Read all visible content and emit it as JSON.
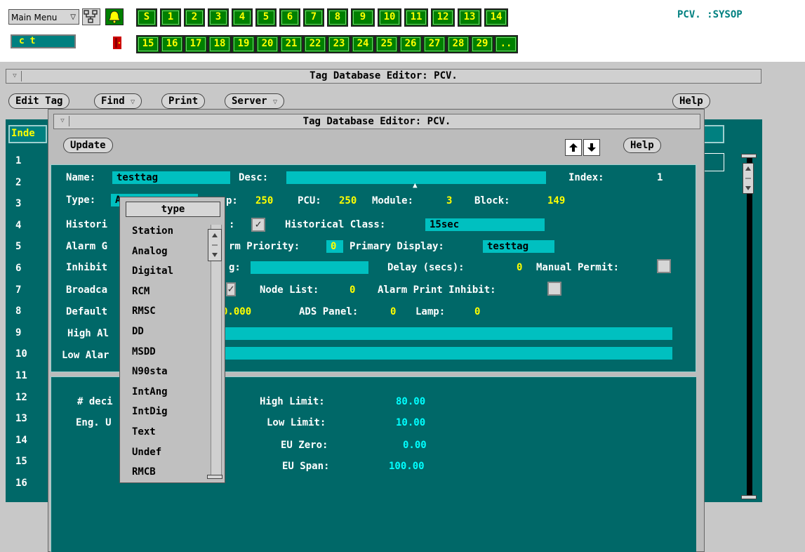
{
  "topbar": {
    "menu_label": "Main Menu",
    "menu_arrow": "▽",
    "ct_field": "c  t",
    "user": "PCV. :SYSOP",
    "display_buttons_row1": [
      "S",
      "1",
      "2",
      "3",
      "4",
      "5",
      "6",
      "7",
      "8",
      "9",
      "10",
      "11",
      "12",
      "13",
      "14"
    ],
    "display_buttons_row2": [
      "15",
      "16",
      "17",
      "18",
      "19",
      "20",
      "21",
      "22",
      "23",
      "24",
      "25",
      "26",
      "27",
      "28",
      "29",
      ".."
    ]
  },
  "main_window": {
    "title": "Tag Database Editor: PCV.",
    "menu": {
      "edit_tag": "Edit Tag",
      "find": "Find",
      "print": "Print",
      "server": "Server",
      "help": "Help"
    },
    "index_header": "Inde",
    "row_numbers": [
      "1",
      "2",
      "3",
      "4",
      "5",
      "6",
      "7",
      "8",
      "9",
      "10",
      "11",
      "12",
      "13",
      "14",
      "15",
      "16"
    ]
  },
  "child_window": {
    "title": "Tag Database Editor: PCV.",
    "update_label": "Update",
    "help_label": "Help",
    "up_arrow": "🠅",
    "down_arrow": "🠇",
    "fields": {
      "name_label": "Name:",
      "name_value": "testtag",
      "desc_label": "Desc:",
      "index_label": "Index:",
      "index_value": "1",
      "type_label": "Type:",
      "type_value_partial": "A",
      "loop_label": "p:",
      "loop_value": "250",
      "pcu_label": "PCU:",
      "pcu_value": "250",
      "module_label": "Module:",
      "module_value": "3",
      "block_label": "Block:",
      "block_value": "149",
      "historical_label": "Histori",
      "historical_check_label": ":",
      "historical_class_label": "Historical Class:",
      "historical_class_value": "15sec",
      "alarm_group_label": "Alarm G",
      "alarm_priority_label": "rm Priority:",
      "alarm_priority_value": "0",
      "primary_display_label": "Primary Display:",
      "primary_display_value": "testtag",
      "inhibit_label": "Inhibit",
      "inhibit_tag_label": "g:",
      "delay_label": "Delay (secs):",
      "delay_value": "0",
      "manual_permit_label": "Manual Permit:",
      "broadcast_label": "Broadca",
      "node_list_label": "Node List:",
      "node_list_value": "0",
      "alarm_print_inhibit_label": "Alarm Print Inhibit:",
      "default_label": "Default",
      "default_value": "0.000",
      "ads_panel_label": "ADS Panel:",
      "ads_panel_value": "0",
      "lamp_label": "Lamp:",
      "lamp_value": "0",
      "high_alarm_label": "High Al",
      "low_alarm_label": "Low Alar"
    },
    "lower": {
      "decimals_label": "# deci",
      "eng_units_label": "Eng. U",
      "high_limit_label": "High Limit:",
      "high_limit_value": "80.00",
      "low_limit_label": "Low Limit:",
      "low_limit_value": "10.00",
      "eu_zero_label": "EU Zero:",
      "eu_zero_value": "0.00",
      "eu_span_label": "EU Span:",
      "eu_span_value": "100.00"
    }
  },
  "type_popup": {
    "title": "type",
    "options": [
      "Station",
      "Analog",
      "Digital",
      "RCM",
      "RMSC",
      "DD",
      "MSDD",
      "N90sta",
      "IntAng",
      "IntDig",
      "Text",
      "Undef",
      "RMCB"
    ]
  },
  "colors": {
    "panel_bg": "#006868",
    "field_cyan": "#00c0c0",
    "display_button_green": "#008000",
    "value_yellow": "#ffff00"
  }
}
